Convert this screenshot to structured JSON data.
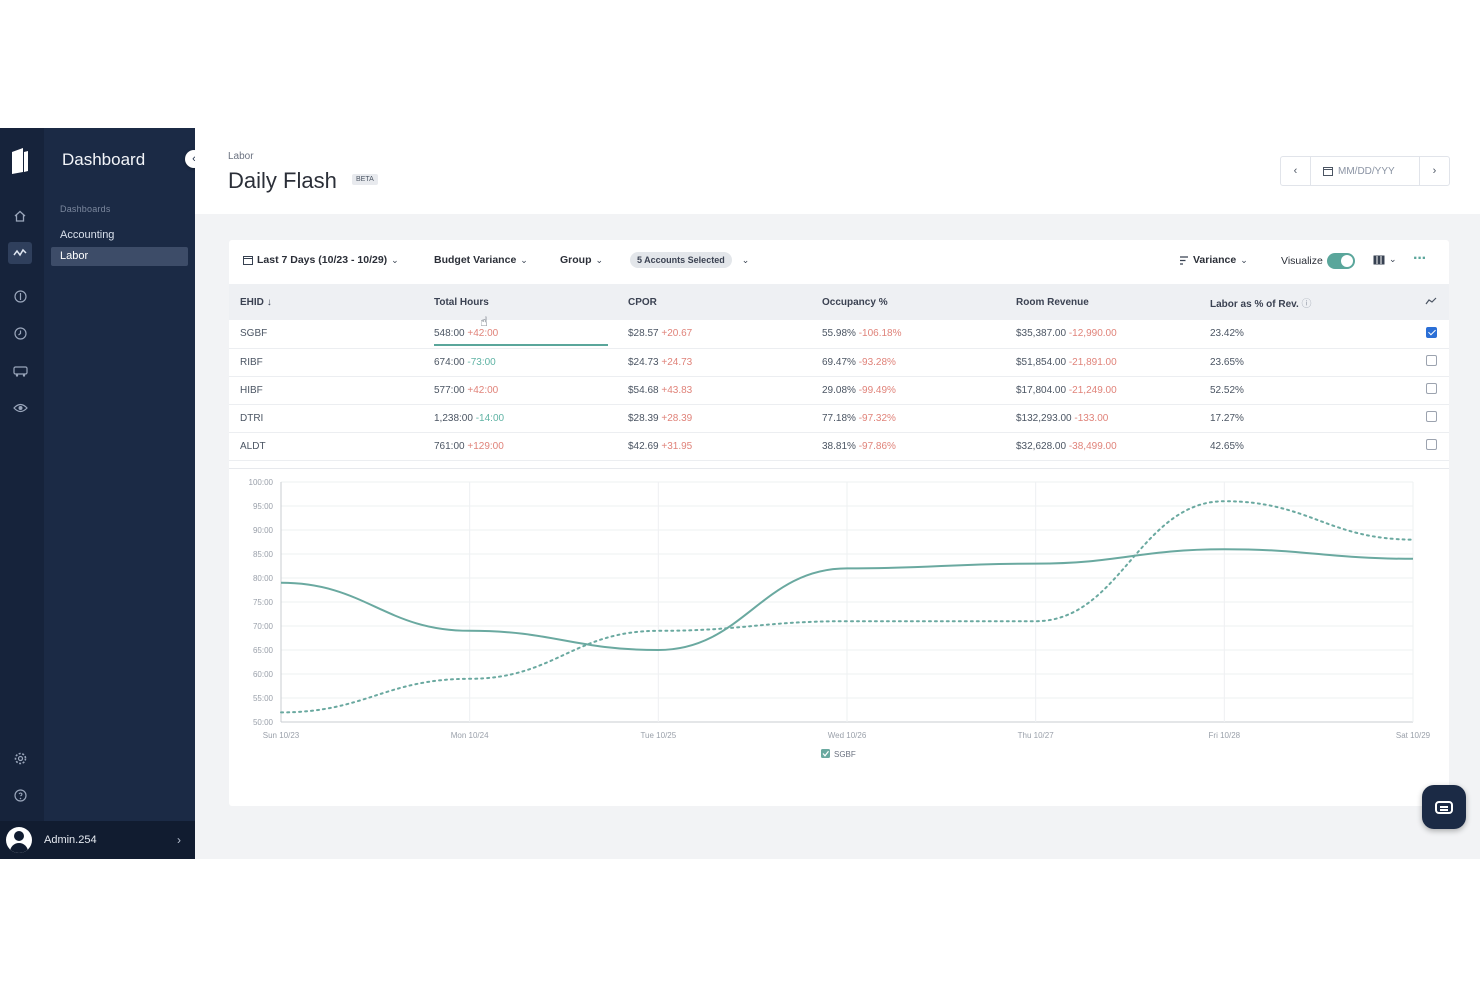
{
  "sidebar": {
    "app_title": "Dashboard",
    "section_label": "Dashboards",
    "items": [
      {
        "label": "Accounting",
        "active": false
      },
      {
        "label": "Labor",
        "active": true
      }
    ],
    "rail_icons": [
      "home-icon",
      "activity-icon",
      "dollar-icon",
      "clock-icon",
      "bus-icon",
      "eye-icon",
      "gear-icon",
      "help-icon"
    ],
    "user_name": "Admin.254"
  },
  "header": {
    "breadcrumb": "Labor",
    "title": "Daily Flash",
    "badge": "BETA",
    "date_placeholder": "MM/DD/YYY"
  },
  "toolbar": {
    "date_range": "Last 7 Days (10/23 - 10/29)",
    "metric": "Budget Variance",
    "group": "Group",
    "accounts": "5 Accounts Selected",
    "sort": "Variance",
    "visualize": "Visualize"
  },
  "table": {
    "columns": [
      "EHID",
      "Total Hours",
      "CPOR",
      "Occupancy %",
      "Room Revenue",
      "Labor as % of Rev."
    ],
    "rows": [
      {
        "ehid": "SGBF",
        "hours": "548:00",
        "hours_var": "+42:00",
        "hours_var_dir": "pos",
        "cpor": "$28.57",
        "cpor_var": "+20.67",
        "occ": "55.98%",
        "occ_var": "-106.18%",
        "rev": "$35,387.00",
        "rev_var": "-12,990.00",
        "labor": "23.42%",
        "checked": true
      },
      {
        "ehid": "RIBF",
        "hours": "674:00",
        "hours_var": "-73:00",
        "hours_var_dir": "neg",
        "cpor": "$24.73",
        "cpor_var": "+24.73",
        "occ": "69.47%",
        "occ_var": "-93.28%",
        "rev": "$51,854.00",
        "rev_var": "-21,891.00",
        "labor": "23.65%",
        "checked": false
      },
      {
        "ehid": "HIBF",
        "hours": "577:00",
        "hours_var": "+42:00",
        "hours_var_dir": "pos",
        "cpor": "$54.68",
        "cpor_var": "+43.83",
        "occ": "29.08%",
        "occ_var": "-99.49%",
        "rev": "$17,804.00",
        "rev_var": "-21,249.00",
        "labor": "52.52%",
        "checked": false
      },
      {
        "ehid": "DTRI",
        "hours": "1,238:00",
        "hours_var": "-14:00",
        "hours_var_dir": "neg",
        "cpor": "$28.39",
        "cpor_var": "+28.39",
        "occ": "77.18%",
        "occ_var": "-97.32%",
        "rev": "$132,293.00",
        "rev_var": "-133.00",
        "labor": "17.27%",
        "checked": false
      },
      {
        "ehid": "ALDT",
        "hours": "761:00",
        "hours_var": "+129:00",
        "hours_var_dir": "pos",
        "cpor": "$42.69",
        "cpor_var": "+31.95",
        "occ": "38.81%",
        "occ_var": "-97.86%",
        "rev": "$32,628.00",
        "rev_var": "-38,499.00",
        "labor": "42.65%",
        "checked": false
      }
    ]
  },
  "chart_data": {
    "type": "line",
    "categories": [
      "Sun 10/23",
      "Mon 10/24",
      "Tue 10/25",
      "Wed 10/26",
      "Thu 10/27",
      "Fri 10/28",
      "Sat 10/29"
    ],
    "y_ticks": [
      "100:00",
      "95:00",
      "90:00",
      "85:00",
      "80:00",
      "75:00",
      "70:00",
      "65:00",
      "60:00",
      "55:00",
      "50:00"
    ],
    "ylim": [
      50,
      100
    ],
    "grid": true,
    "legend_position": "bottom",
    "series": [
      {
        "name": "SGBF",
        "style": "solid",
        "color": "#6aa9a0",
        "values": [
          79,
          69,
          65,
          82,
          83,
          86,
          84
        ]
      },
      {
        "style": "dotted",
        "color": "#6aa9a0",
        "values": [
          52,
          59,
          69,
          71,
          71,
          96,
          88
        ]
      }
    ]
  },
  "colors": {
    "accent": "#5aa69b",
    "positive_variance": "#e0837a",
    "negative_variance": "#5fb3a4",
    "sidebar": "#1b2a45"
  }
}
